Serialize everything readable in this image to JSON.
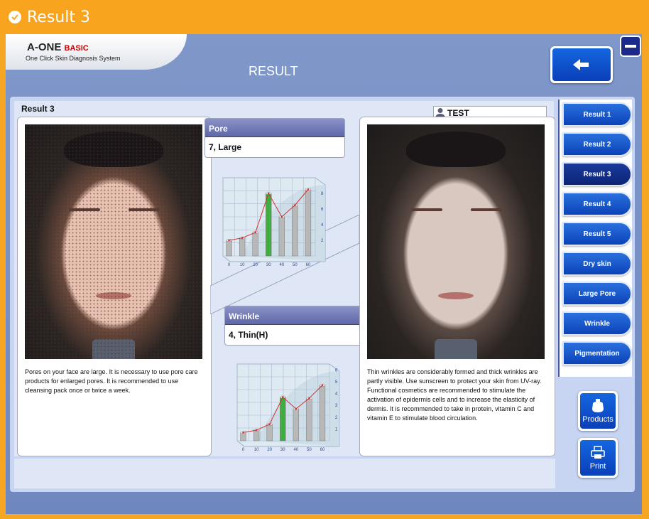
{
  "window": {
    "title": "Result 3"
  },
  "header": {
    "logo_brand": "A-ONE",
    "logo_edition": "BASIC",
    "logo_tagline": "One Click Skin Diagnosis System",
    "page_title": "RESULT"
  },
  "content": {
    "result_label": "Result 3",
    "user_name": "TEST",
    "left_description": "Pores on your face are large. It is necessary to use pore care products for enlarged pores. It is recommended to use cleansing pack once or twice a week.",
    "right_description": "Thin wrinkles are considerably formed and thick wrinkles are partly visible. Use sunscreen to protect your skin from UV-ray. Functional cosmetics are recommended to stimulate the activation of epidermis cells and to increase the elasticity of dermis. It is recommended to take in protein, vitamin C and vitamin E to stimulate blood circulation.",
    "pore": {
      "title": "Pore",
      "value": "7,  Large"
    },
    "wrinkle": {
      "title": "Wrinkle",
      "value": "4,  Thin(H)"
    }
  },
  "sidebar": {
    "items": [
      {
        "label": "Result 1",
        "active": false
      },
      {
        "label": "Result 2",
        "active": false
      },
      {
        "label": "Result 3",
        "active": true
      },
      {
        "label": "Result 4",
        "active": false
      },
      {
        "label": "Result 5",
        "active": false
      },
      {
        "label": "Dry skin",
        "active": false
      },
      {
        "label": "Large Pore",
        "active": false
      },
      {
        "label": "Wrinkle",
        "active": false
      },
      {
        "label": "Pigmentation",
        "active": false
      }
    ]
  },
  "tools": {
    "products_label": "Products",
    "print_label": "Print"
  },
  "chart_data": [
    {
      "type": "bar",
      "categories": [
        "0",
        "10",
        "20",
        "30",
        "40",
        "50",
        "60"
      ],
      "values": [
        2,
        2.3,
        3,
        8,
        5,
        6.5,
        8.5
      ],
      "highlight_index": 3,
      "yticks": [
        "2",
        "4",
        "6",
        "8"
      ],
      "ylim": [
        0,
        10
      ],
      "colors": {
        "bar": "#b8b8b8",
        "highlight": "#3fae3f",
        "curve": "#d33030"
      }
    },
    {
      "type": "bar",
      "categories": [
        "0",
        "10",
        "20",
        "30",
        "40",
        "50",
        "60"
      ],
      "values": [
        0.7,
        0.9,
        1.4,
        3.7,
        2.7,
        3.6,
        4.7
      ],
      "highlight_index": 3,
      "yticks": [
        "1",
        "2",
        "3",
        "4",
        "5",
        "6"
      ],
      "ylim": [
        0,
        6.5
      ],
      "colors": {
        "bar": "#b8b8b8",
        "highlight": "#3fae3f",
        "curve": "#d33030"
      }
    }
  ]
}
